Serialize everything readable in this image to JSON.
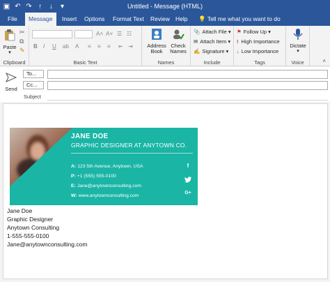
{
  "window": {
    "title": "Untitled  -  Message (HTML)"
  },
  "tabs": [
    {
      "label": "File"
    },
    {
      "label": "Message"
    },
    {
      "label": "Insert"
    },
    {
      "label": "Options"
    },
    {
      "label": "Format Text"
    },
    {
      "label": "Review"
    },
    {
      "label": "Help"
    },
    {
      "label": "Tell me what you want to do"
    }
  ],
  "ribbon": {
    "clipboard": {
      "paste": "Paste",
      "group": "Clipboard"
    },
    "basic_text": {
      "group": "Basic Text"
    },
    "names": {
      "address_book": "Address Book",
      "check_names": "Check Names",
      "group": "Names"
    },
    "include": {
      "attach_file": "Attach File",
      "attach_item": "Attach Item",
      "signature": "Signature",
      "group": "Include"
    },
    "tags": {
      "follow_up": "Follow Up",
      "high_importance": "High Importance",
      "low_importance": "Low Importance",
      "group": "Tags"
    },
    "voice": {
      "dictate": "Dictate",
      "group": "Voice"
    }
  },
  "compose": {
    "send": "Send",
    "to": "To...",
    "cc": "Cc...",
    "subject": "Subject"
  },
  "signature_card": {
    "name": "JANE DOE",
    "title": "GRAPHIC DESIGNER AT ANYTOWN CO.",
    "address_label": "A:",
    "address": "123 5th Avenue, Anytown, USA",
    "phone_label": "P:",
    "phone": "+1 (555) 555-0100",
    "email_label": "E:",
    "email": "Jane@anytownconsulting.com",
    "web_label": "W:",
    "web": "www.anytownconsulting.com",
    "social": [
      "f",
      "t",
      "G+"
    ],
    "accent_color": "#1ab5a5"
  },
  "plain_signature": {
    "name": "Jane Doe",
    "title": "Graphic Designer",
    "company": "Anytown Consulting",
    "phone": "1-555-555-0100",
    "email": "Jane@anytownconsulting.com"
  }
}
